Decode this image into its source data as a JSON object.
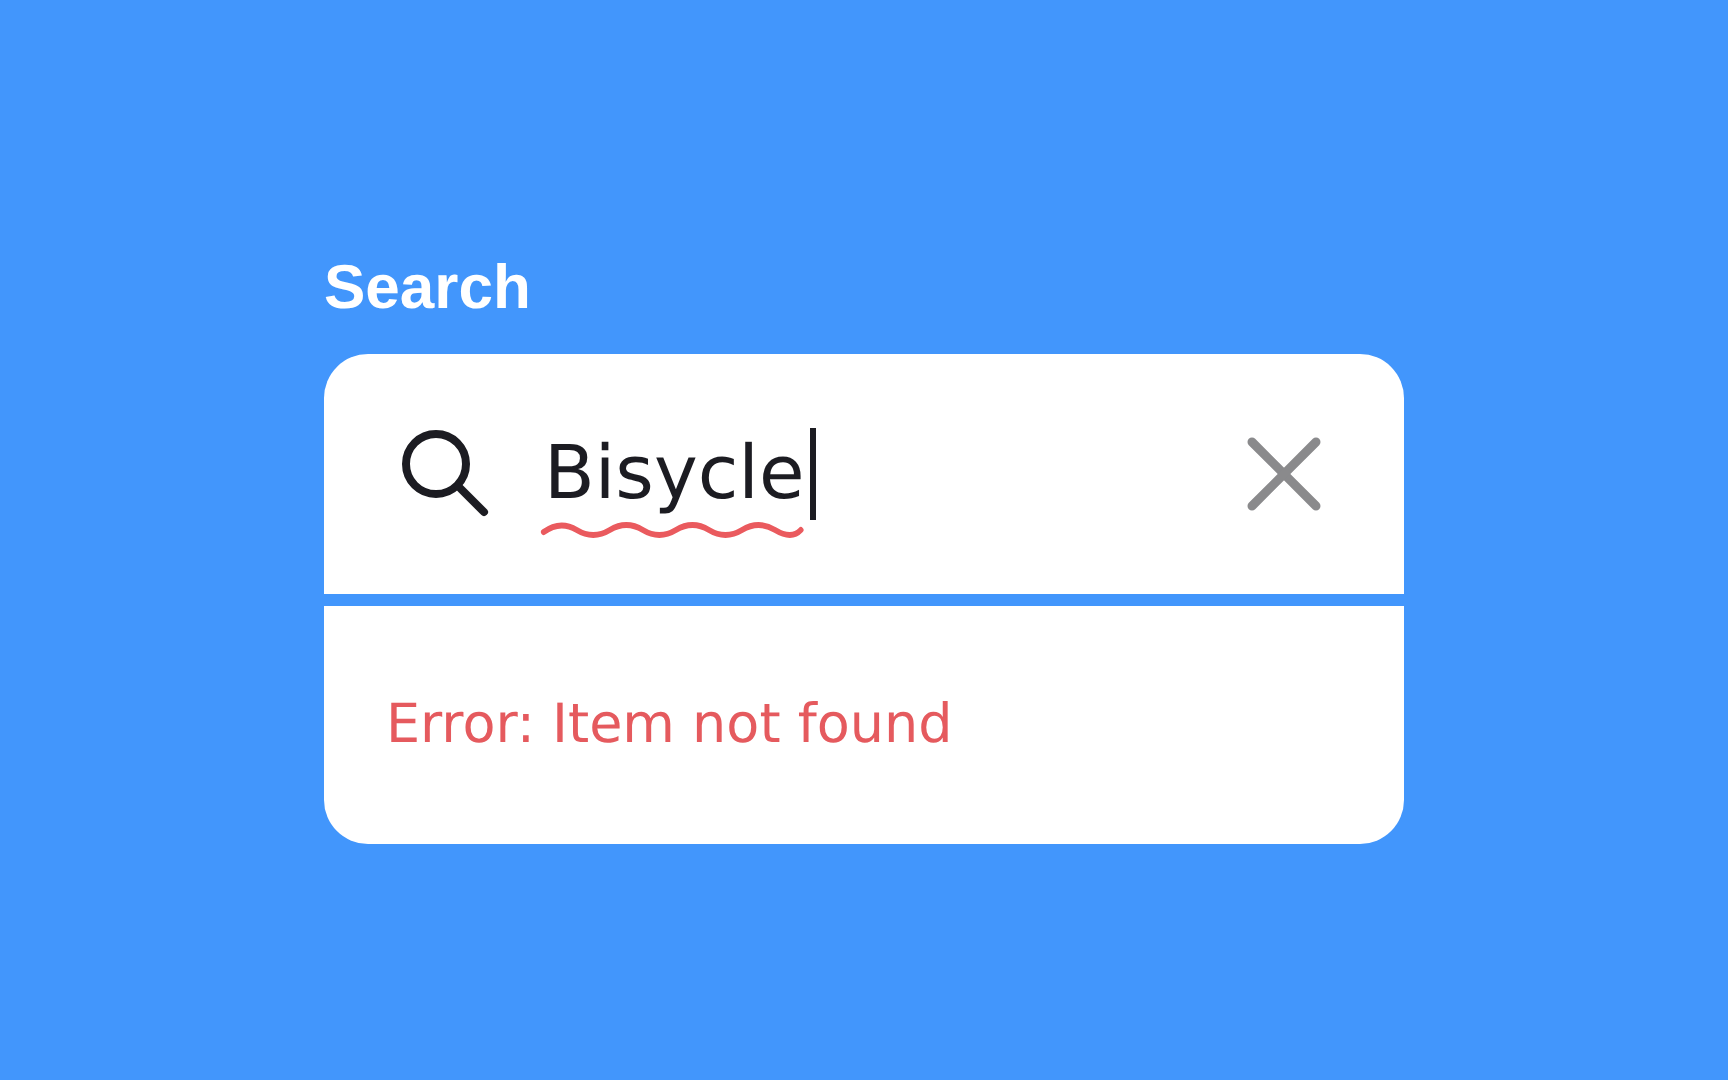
{
  "label": "Search",
  "search": {
    "value": "Bisycle",
    "misspelled": true,
    "focused": true
  },
  "error": "Error: Item not found"
}
